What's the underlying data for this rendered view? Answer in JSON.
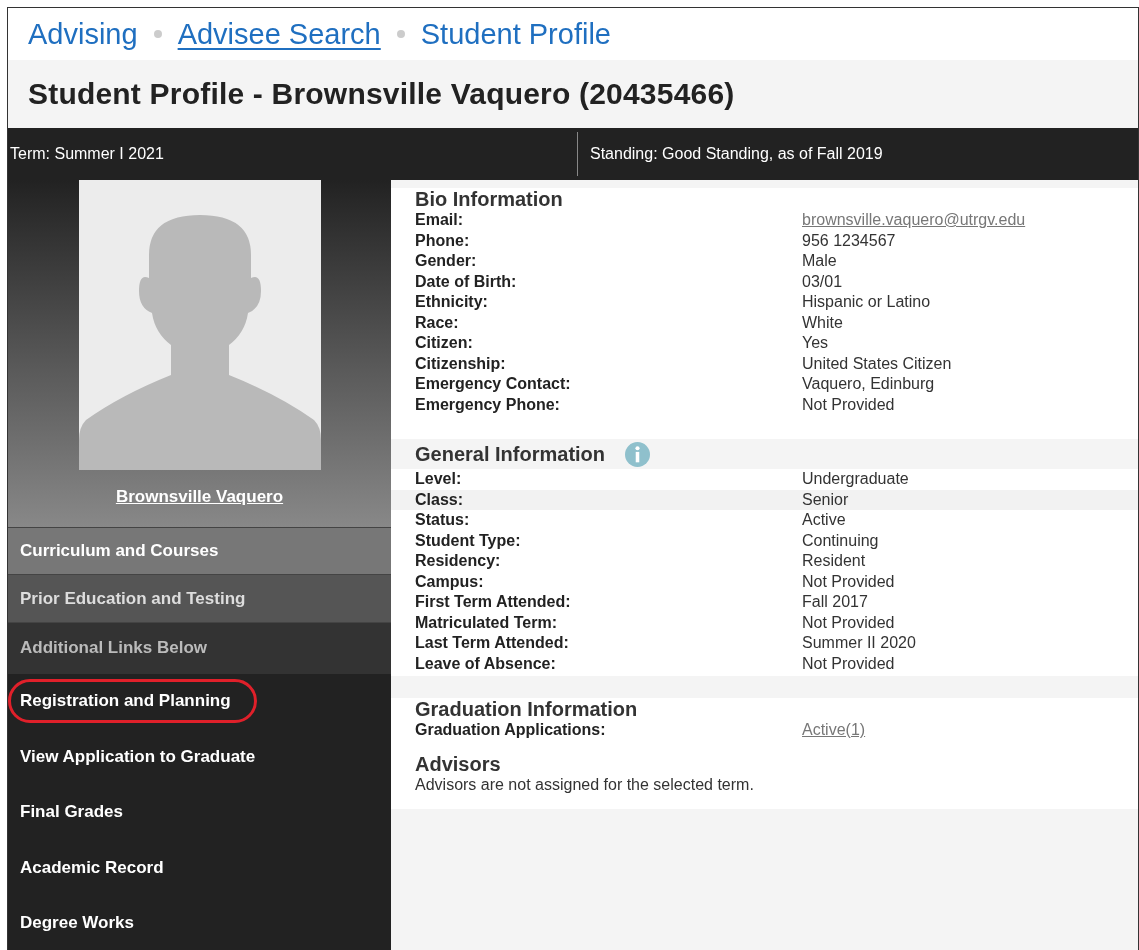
{
  "breadcrumb": [
    {
      "label": "Advising",
      "underlined": false
    },
    {
      "label": "Advisee Search",
      "underlined": true
    },
    {
      "label": "Student Profile",
      "underlined": false
    }
  ],
  "title": "Student Profile - Brownsville Vaquero (20435466)",
  "info_bar": [
    {
      "label": "Term:",
      "value": "Summer I 2021"
    },
    {
      "label": "Standing:",
      "value": "Good Standing, as of Fall 2019"
    }
  ],
  "sidebar": {
    "student_name": "Brownsville Vaquero",
    "items": [
      {
        "label": "Curriculum and Courses",
        "kind": "primary",
        "circled": false
      },
      {
        "label": "Prior Education and Testing",
        "kind": "secondary",
        "circled": false
      },
      {
        "label": "Additional Links Below",
        "kind": "header",
        "circled": false
      },
      {
        "label": "Registration and Planning",
        "kind": "link",
        "circled": true
      },
      {
        "label": "View Application to Graduate",
        "kind": "link",
        "circled": false
      },
      {
        "label": "Final Grades",
        "kind": "link",
        "circled": false
      },
      {
        "label": "Academic Record",
        "kind": "link",
        "circled": false
      },
      {
        "label": "Degree Works",
        "kind": "link",
        "circled": false
      }
    ]
  },
  "sections": [
    {
      "title": "Bio Information",
      "rows": [
        {
          "label": "Email:",
          "value": "brownsville.vaquero@utrgv.edu",
          "kind": "link",
          "hovered": false
        },
        {
          "label": "Phone:",
          "value": "956 1234567",
          "kind": "text",
          "hovered": false
        },
        {
          "label": "Gender:",
          "value": "Male",
          "kind": "text",
          "hovered": false
        },
        {
          "label": "Date of Birth:",
          "value": "03/01",
          "kind": "text",
          "hovered": false
        },
        {
          "label": "Ethnicity:",
          "value": "Hispanic or Latino",
          "kind": "text",
          "hovered": false
        },
        {
          "label": "Race:",
          "value": "White",
          "kind": "text",
          "hovered": false
        },
        {
          "label": "Citizen:",
          "value": "Yes",
          "kind": "text",
          "hovered": false
        },
        {
          "label": "Citizenship:",
          "value": "United States Citizen",
          "kind": "text",
          "hovered": false
        },
        {
          "label": "Emergency Contact:",
          "value": "Vaquero, Edinburg",
          "kind": "text",
          "hovered": false
        },
        {
          "label": "Emergency Phone:",
          "value": "Not Provided",
          "kind": "text",
          "hovered": false
        }
      ]
    },
    {
      "title": "General Information",
      "info_icon": true,
      "rows": [
        {
          "label": "Level:",
          "value": "Undergraduate",
          "kind": "text",
          "hovered": false
        },
        {
          "label": "Class:",
          "value": "Senior",
          "kind": "text",
          "hovered": true
        },
        {
          "label": "Status:",
          "value": "Active",
          "kind": "text",
          "hovered": false
        },
        {
          "label": "Student Type:",
          "value": "Continuing",
          "kind": "text",
          "hovered": false
        },
        {
          "label": "Residency:",
          "value": "Resident",
          "kind": "text",
          "hovered": false
        },
        {
          "label": "Campus:",
          "value": "Not Provided",
          "kind": "text",
          "hovered": false
        },
        {
          "label": "First Term Attended:",
          "value": "Fall 2017",
          "kind": "text",
          "hovered": false
        },
        {
          "label": "Matriculated Term:",
          "value": "Not Provided",
          "kind": "text",
          "hovered": false
        },
        {
          "label": "Last Term Attended:",
          "value": "Summer II 2020",
          "kind": "text",
          "hovered": false
        },
        {
          "label": "Leave of Absence:",
          "value": "Not Provided",
          "kind": "text",
          "hovered": false
        }
      ]
    },
    {
      "title": "Graduation Information",
      "rows": [
        {
          "label": "Graduation Applications:",
          "value": "Active(1)",
          "kind": "link",
          "hovered": false
        }
      ]
    },
    {
      "title": "Advisors",
      "note": "Advisors are not assigned for the selected term."
    }
  ]
}
